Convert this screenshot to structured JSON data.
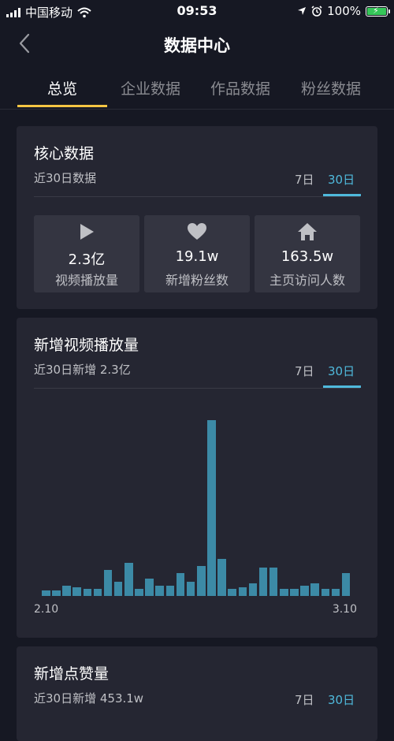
{
  "status_bar": {
    "carrier": "中国移动",
    "time": "09:53",
    "battery": "100%"
  },
  "nav": {
    "title": "数据中心"
  },
  "tabs": [
    {
      "label": "总览",
      "active": true
    },
    {
      "label": "企业数据",
      "active": false
    },
    {
      "label": "作品数据",
      "active": false
    },
    {
      "label": "粉丝数据",
      "active": false
    }
  ],
  "core": {
    "title": "核心数据",
    "subtitle": "近30日数据",
    "range_7": "7日",
    "range_30": "30日",
    "stats": [
      {
        "icon": "play-icon",
        "value": "2.3亿",
        "label": "视频播放量"
      },
      {
        "icon": "heart-icon",
        "value": "19.1w",
        "label": "新增粉丝数"
      },
      {
        "icon": "home-icon",
        "value": "163.5w",
        "label": "主页访问人数"
      }
    ]
  },
  "plays": {
    "title": "新增视频播放量",
    "subtitle": "近30日新增 2.3亿",
    "range_7": "7日",
    "range_30": "30日",
    "x_start": "2.10",
    "x_end": "3.10"
  },
  "likes": {
    "title": "新增点赞量",
    "subtitle": "近30日新增 453.1w",
    "range_7": "7日",
    "range_30": "30日"
  },
  "chart_data": {
    "type": "bar",
    "title": "新增视频播放量",
    "xlabel": "",
    "ylabel": "",
    "x_tick_labels": [
      "2.10",
      "3.10"
    ],
    "values": [
      3,
      3,
      6,
      5,
      4,
      4,
      15,
      8,
      19,
      4,
      10,
      6,
      6,
      13,
      8,
      17,
      100,
      21,
      4,
      5,
      7,
      16,
      16,
      4,
      4,
      6,
      7,
      4,
      4,
      13
    ],
    "grid": false
  }
}
